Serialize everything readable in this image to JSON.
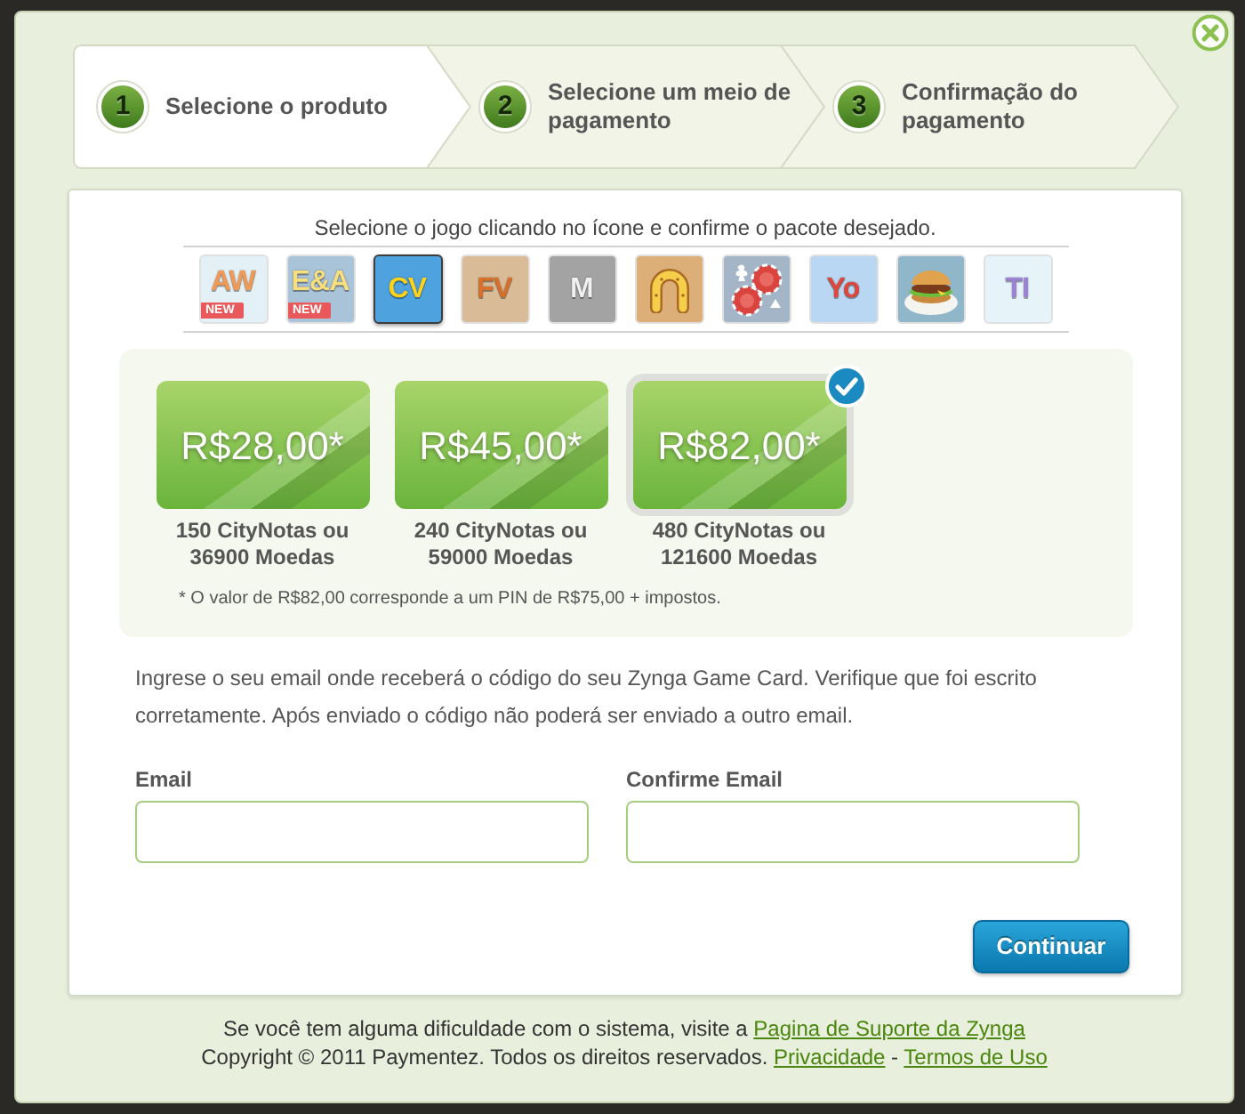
{
  "steps": [
    {
      "number": "1",
      "label": "Selecione o produto",
      "selected": true
    },
    {
      "number": "2",
      "label": "Selecione um meio de pagamento",
      "selected": false
    },
    {
      "number": "3",
      "label": "Confirmação do pagamento",
      "selected": false
    }
  ],
  "game_picker": {
    "instruction": "Selecione o jogo clicando no ícone e confirme o pacote desejado.",
    "games": [
      {
        "kind": "logo",
        "logo": {
          "text": "AW",
          "color": "#f09a55"
        },
        "badge": "NEW",
        "color": "#e3f1f7",
        "selected": false
      },
      {
        "kind": "logo",
        "logo": {
          "text": "E&A",
          "color": "#f7df7e"
        },
        "badge": "NEW",
        "color": "#a9c3d9",
        "selected": false
      },
      {
        "kind": "logo",
        "logo": {
          "text": "CV",
          "color": "#ffd31c"
        },
        "color": "#4ea2de",
        "selected": true
      },
      {
        "kind": "logo",
        "logo": {
          "text": "FV",
          "color": "#d8702a"
        },
        "color": "#d9bb97",
        "selected": false
      },
      {
        "kind": "logo",
        "logo": {
          "text": "M",
          "color": "#f0f0f0"
        },
        "color": "#a3a3a3",
        "selected": false
      },
      {
        "kind": "horseshoe",
        "color": "#dcae78",
        "selected": false
      },
      {
        "kind": "chips",
        "color": "#a3b5c7",
        "selected": false
      },
      {
        "kind": "logo",
        "logo": {
          "text": "Yo",
          "color": "#e0473c"
        },
        "color": "#b9d7f2",
        "selected": false
      },
      {
        "kind": "burger",
        "color": "#8fb6c9",
        "selected": false
      },
      {
        "kind": "logo",
        "logo": {
          "text": "TI",
          "color": "#9b82d6"
        },
        "color": "#e6f3f8",
        "selected": false
      }
    ]
  },
  "packages": {
    "items": [
      {
        "price": "R$28,00*",
        "description": "150 CityNotas ou 36900 Moedas",
        "selected": false
      },
      {
        "price": "R$45,00*",
        "description": "240 CityNotas ou 59000 Moedas",
        "selected": false
      },
      {
        "price": "R$82,00*",
        "description": "480 CityNotas ou 121600 Moedas",
        "selected": true
      }
    ],
    "footnote": "* O valor de R$82,00 corresponde a um PIN de R$75,00 + impostos."
  },
  "email_form": {
    "intro": "Ingrese o seu email onde receberá o código do seu Zynga Game Card. Verifique que foi escrito corretamente. Após enviado o código não poderá ser enviado a outro email.",
    "fields": [
      {
        "label": "Email"
      },
      {
        "label": "Confirme Email"
      }
    ],
    "submit": "Continuar"
  },
  "footer": {
    "support_text": "Se você tem alguma dificuldade com o sistema, visite a",
    "support_link": "Pagina de Suporte da Zynga",
    "copyright": "Copyright © 2011 Paymentez. Todos os direitos reservados.",
    "links": [
      "Privacidade",
      "Termos de Uso"
    ],
    "separator": "-"
  }
}
